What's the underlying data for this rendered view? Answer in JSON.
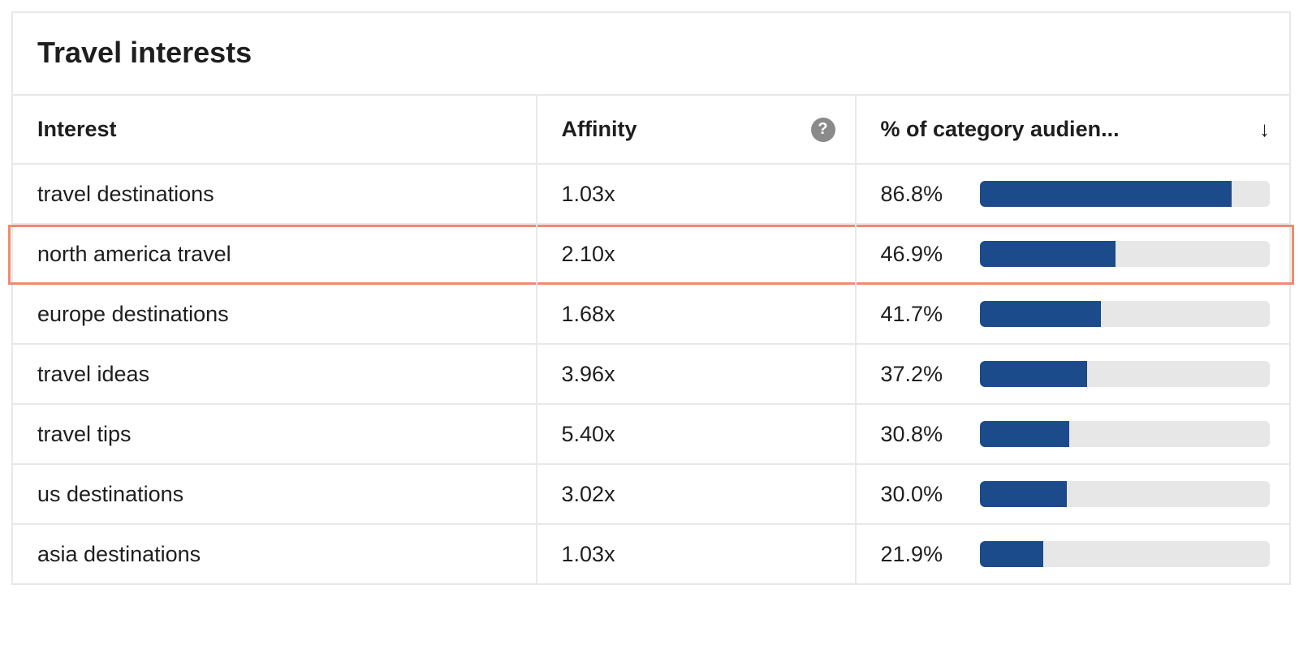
{
  "panel": {
    "title": "Travel interests",
    "headers": {
      "interest": "Interest",
      "affinity": "Affinity",
      "pct": "% of category audien..."
    }
  },
  "chart_data": {
    "type": "bar",
    "title": "Travel interests",
    "xlabel": "% of category audience",
    "xlim": [
      0,
      100
    ],
    "categories": [
      "travel destinations",
      "north america travel",
      "europe destinations",
      "travel ideas",
      "travel tips",
      "us destinations",
      "asia destinations"
    ],
    "series": [
      {
        "name": "Affinity",
        "values": [
          1.03,
          2.1,
          1.68,
          3.96,
          5.4,
          3.02,
          1.03
        ]
      },
      {
        "name": "% of category audience",
        "values": [
          86.8,
          46.9,
          41.7,
          37.2,
          30.8,
          30.0,
          21.9
        ]
      }
    ]
  },
  "rows": [
    {
      "interest": "travel destinations",
      "affinity": "1.03x",
      "pct_label": "86.8%",
      "pct_value": 86.8,
      "highlight": false
    },
    {
      "interest": "north america travel",
      "affinity": "2.10x",
      "pct_label": "46.9%",
      "pct_value": 46.9,
      "highlight": true
    },
    {
      "interest": "europe destinations",
      "affinity": "1.68x",
      "pct_label": "41.7%",
      "pct_value": 41.7,
      "highlight": false
    },
    {
      "interest": "travel ideas",
      "affinity": "3.96x",
      "pct_label": "37.2%",
      "pct_value": 37.2,
      "highlight": false
    },
    {
      "interest": "travel tips",
      "affinity": "5.40x",
      "pct_label": "30.8%",
      "pct_value": 30.8,
      "highlight": false
    },
    {
      "interest": "us destinations",
      "affinity": "3.02x",
      "pct_label": "30.0%",
      "pct_value": 30.0,
      "highlight": false
    },
    {
      "interest": "asia destinations",
      "affinity": "1.03x",
      "pct_label": "21.9%",
      "pct_value": 21.9,
      "highlight": false
    }
  ]
}
